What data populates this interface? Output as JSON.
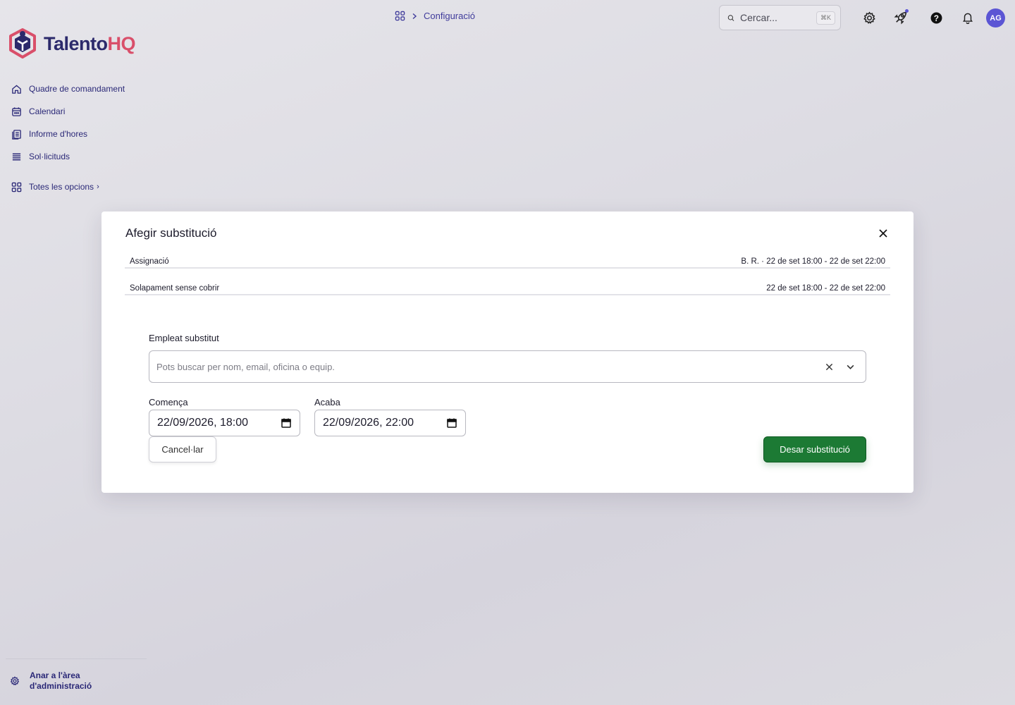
{
  "brand": {
    "name_part1": "Talento",
    "name_part2": "HQ",
    "accent": "#d94f6a",
    "primary": "#2c2a6b"
  },
  "header": {
    "breadcrumb": {
      "icon": "grid-icon",
      "separator": "chevron-right-icon",
      "current": "Configuració"
    },
    "search": {
      "placeholder": "Cercar...",
      "shortcut": "⌘K"
    },
    "icons": [
      "gear-icon",
      "rocket-icon",
      "help-icon",
      "bell-icon"
    ],
    "avatar_initials": "AG",
    "avatar_color": "#5b55d4"
  },
  "sidebar": {
    "items": [
      {
        "label": "Quadre de comandament",
        "icon": "home-icon"
      },
      {
        "label": "Calendari",
        "icon": "calendar-icon"
      },
      {
        "label": "Informe d'hores",
        "icon": "timesheet-icon"
      },
      {
        "label": "Sol·licituds",
        "icon": "list-icon"
      }
    ],
    "all_options": {
      "label": "Totes les opcions",
      "icon": "grid-icon"
    },
    "admin": {
      "line1": "Anar a l'àrea",
      "line2": "d'administració",
      "icon": "gear-icon"
    }
  },
  "modal": {
    "title": "Afegir substitució",
    "rows": [
      {
        "label": "Assignació",
        "value": "B. R. · 22 de set 18:00 - 22 de set 22:00"
      },
      {
        "label": "Solapament sense cobrir",
        "value": "22 de set 18:00 - 22 de set 22:00"
      }
    ],
    "employee": {
      "label": "Empleat substitut",
      "placeholder": "Pots buscar per nom, email, oficina o equip.",
      "value": ""
    },
    "start": {
      "label": "Comença",
      "value": "22/09/2026, 18:00"
    },
    "end": {
      "label": "Acaba",
      "value": "22/09/2026, 22:00"
    },
    "cancel_label": "Cancel·lar",
    "save_label": "Desar substitució",
    "save_color": "#1c7a34"
  }
}
